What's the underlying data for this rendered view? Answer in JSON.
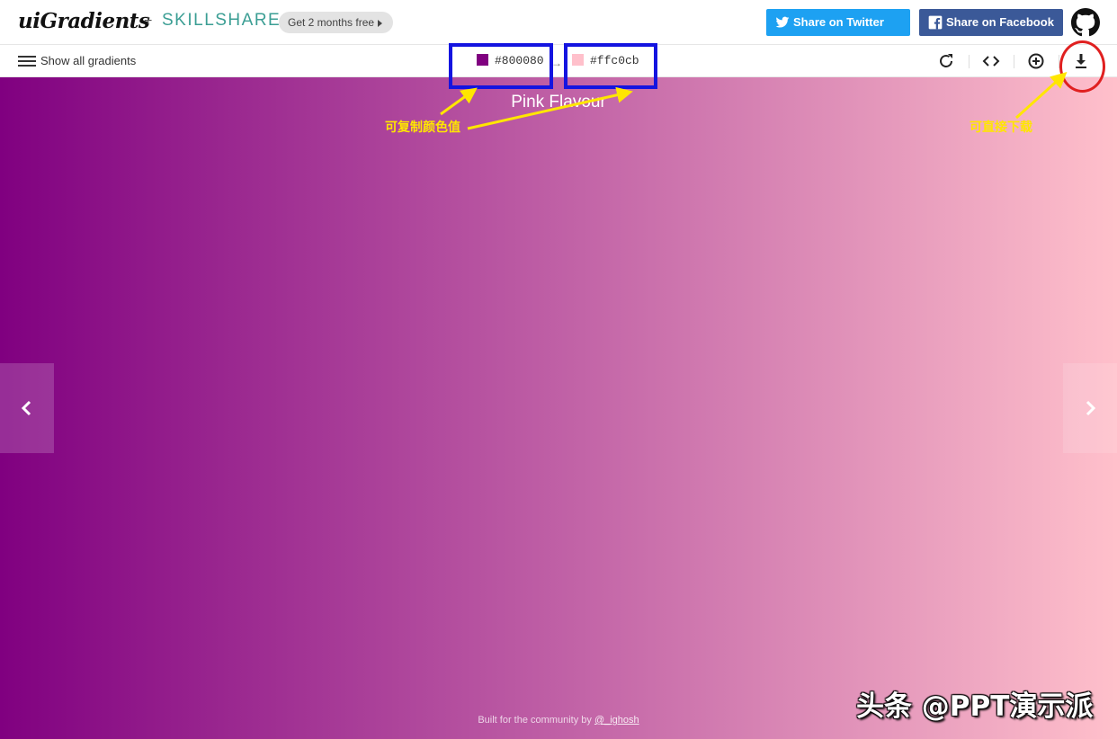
{
  "header": {
    "logo": "uiGradients",
    "plus": "+",
    "partner": "SKILLSHARE",
    "promo_label": "Get 2 months free",
    "twitter_label": "Share on Twitter",
    "facebook_label": "Share on Facebook",
    "github_icon": "github-icon"
  },
  "toolbar": {
    "menu_label": "Show all gradients",
    "color_from": "#800080",
    "color_to": "#ffc0cb",
    "arrow": "→",
    "tools": [
      "rotate-icon",
      "code-icon",
      "add-icon",
      "download-icon"
    ]
  },
  "gradient": {
    "name": "Pink Flavour",
    "start_color": "#800080",
    "end_color": "#ffc0cb",
    "footer_text": "Built for the community by",
    "footer_link": "@_ighosh"
  },
  "annotations": {
    "copy_note": "可复制颜色值",
    "download_note": "可直接下载",
    "box_color": "#1414e0",
    "ring_color": "#e02020",
    "arrow_color": "#ffe600"
  },
  "watermark": "头条 @PPT演示派"
}
